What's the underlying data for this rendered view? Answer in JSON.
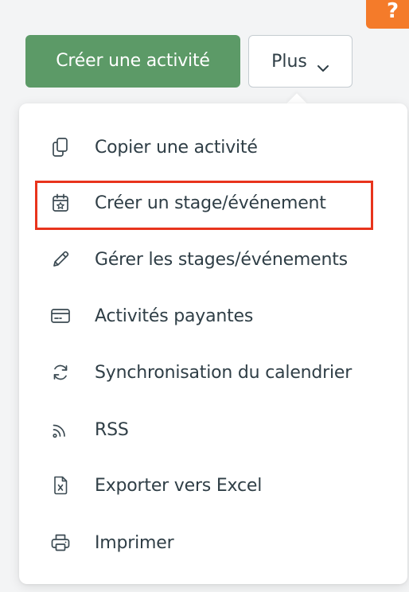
{
  "help_badge": {
    "label": "?",
    "color": "#f47b2a"
  },
  "toolbar": {
    "create_label": "Créer une activité",
    "create_color": "#5c9a67",
    "more_label": "Plus",
    "more_icon": "chevron-down-icon"
  },
  "menu": {
    "highlighted_item": "Créer un stage/événement",
    "highlight_color": "#e8341c",
    "items": [
      {
        "label": "Copier une activité",
        "icon": "copy-icon"
      },
      {
        "label": "Créer un stage/événement",
        "icon": "calendar-star-icon"
      },
      {
        "label": "Gérer les stages/événements",
        "icon": "pencil-icon"
      },
      {
        "label": "Activités payantes",
        "icon": "credit-card-icon"
      },
      {
        "label": "Synchronisation du calendrier",
        "icon": "sync-icon"
      },
      {
        "label": "RSS",
        "icon": "rss-icon"
      },
      {
        "label": "Exporter vers Excel",
        "icon": "excel-file-icon"
      },
      {
        "label": "Imprimer",
        "icon": "printer-icon"
      }
    ]
  }
}
